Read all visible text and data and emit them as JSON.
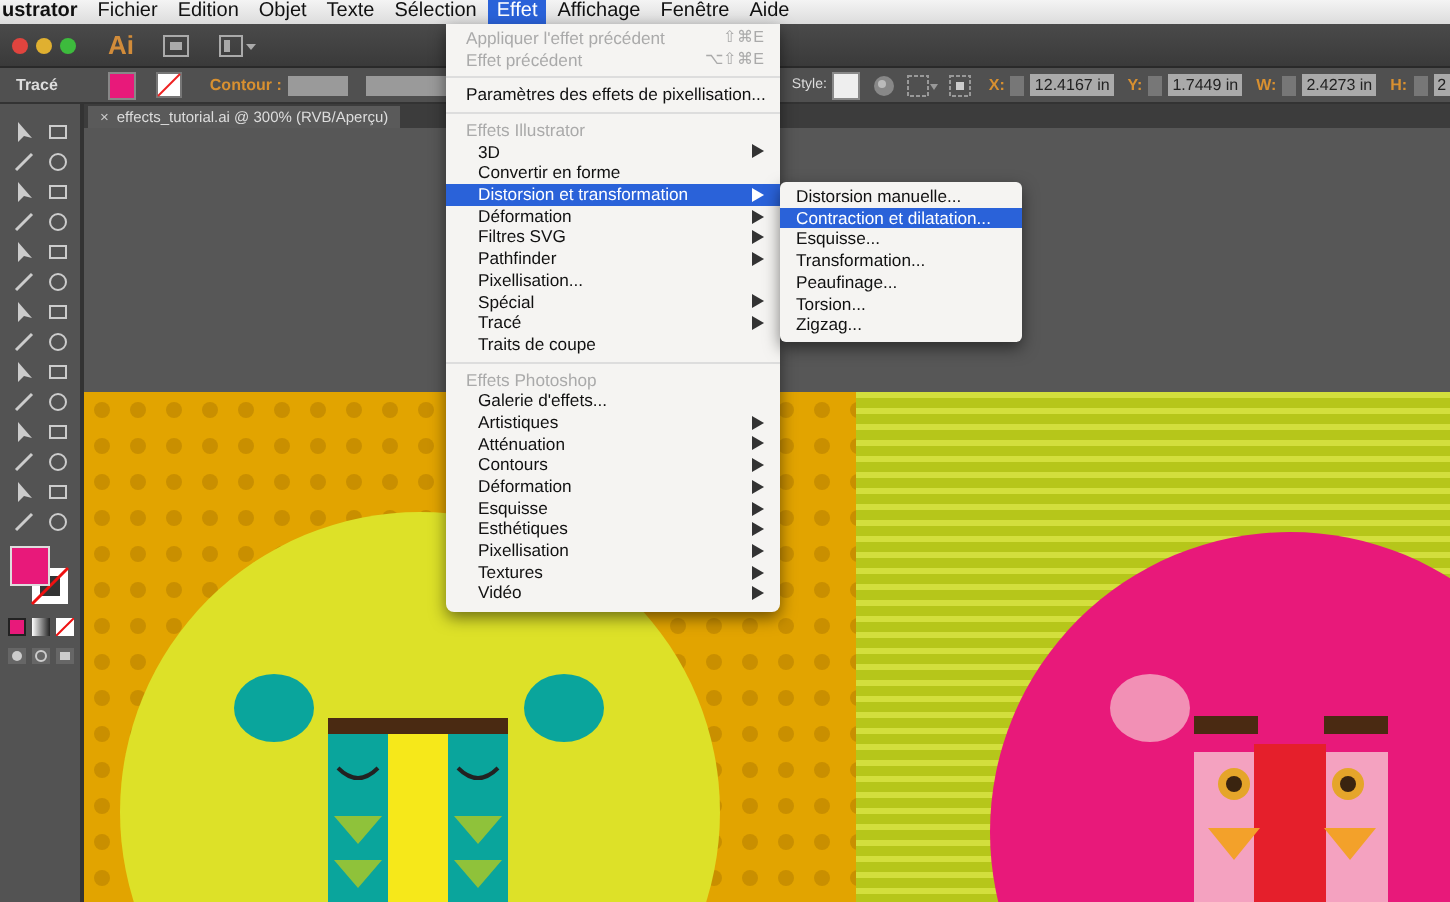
{
  "menu_bar": {
    "items": [
      {
        "label": "ustrator",
        "selected": false
      },
      {
        "label": "Fichier",
        "selected": false
      },
      {
        "label": "Edition",
        "selected": false
      },
      {
        "label": "Objet",
        "selected": false
      },
      {
        "label": "Texte",
        "selected": false
      },
      {
        "label": "Sélection",
        "selected": false
      },
      {
        "label": "Effet",
        "selected": true
      },
      {
        "label": "Affichage",
        "selected": false
      },
      {
        "label": "Fenêtre",
        "selected": false
      },
      {
        "label": "Aide",
        "selected": false
      }
    ]
  },
  "app_bar": {
    "logo": "Ai"
  },
  "control_bar": {
    "panel_label": "Tracé",
    "stroke_label": "Contour :",
    "style_label": "Style:",
    "fields": [
      {
        "label": "X:",
        "value": "12.4167 in"
      },
      {
        "label": "Y:",
        "value": "1.7449 in"
      },
      {
        "label": "W:",
        "value": "2.4273 in"
      },
      {
        "label": "H:",
        "value": "2"
      }
    ]
  },
  "document_tab": {
    "close": "×",
    "title": "effects_tutorial.ai @ 300% (RVB/Aperçu)"
  },
  "effect_menu": {
    "sections": [
      {
        "items": [
          {
            "label": "Appliquer l'effet précédent",
            "shortcut": "⇧⌘E",
            "disabled": true,
            "submenu": false,
            "selected": false
          },
          {
            "label": "Effet précédent",
            "shortcut": "⌥⇧⌘E",
            "disabled": true,
            "submenu": false,
            "selected": false
          }
        ]
      },
      {
        "items": [
          {
            "label": "Paramètres des effets de pixellisation...",
            "disabled": false,
            "submenu": false,
            "selected": false
          }
        ]
      },
      {
        "header": "Effets Illustrator",
        "items": [
          {
            "label": "3D",
            "disabled": false,
            "submenu": true,
            "selected": false
          },
          {
            "label": "Convertir en forme",
            "disabled": false,
            "submenu": false,
            "selected": false
          },
          {
            "label": "Distorsion et transformation",
            "disabled": false,
            "submenu": true,
            "selected": true
          },
          {
            "label": "Déformation",
            "disabled": false,
            "submenu": true,
            "selected": false
          },
          {
            "label": "Filtres SVG",
            "disabled": false,
            "submenu": true,
            "selected": false
          },
          {
            "label": "Pathfinder",
            "disabled": false,
            "submenu": true,
            "selected": false
          },
          {
            "label": "Pixellisation...",
            "disabled": false,
            "submenu": false,
            "selected": false
          },
          {
            "label": "Spécial",
            "disabled": false,
            "submenu": true,
            "selected": false
          },
          {
            "label": "Tracé",
            "disabled": false,
            "submenu": true,
            "selected": false
          },
          {
            "label": "Traits de coupe",
            "disabled": false,
            "submenu": false,
            "selected": false
          }
        ]
      },
      {
        "header": "Effets Photoshop",
        "items": [
          {
            "label": "Galerie d'effets...",
            "disabled": false,
            "submenu": false,
            "selected": false
          },
          {
            "label": "Artistiques",
            "disabled": false,
            "submenu": true,
            "selected": false
          },
          {
            "label": "Atténuation",
            "disabled": false,
            "submenu": true,
            "selected": false
          },
          {
            "label": "Contours",
            "disabled": false,
            "submenu": true,
            "selected": false
          },
          {
            "label": "Déformation",
            "disabled": false,
            "submenu": true,
            "selected": false
          },
          {
            "label": "Esquisse",
            "disabled": false,
            "submenu": true,
            "selected": false
          },
          {
            "label": "Esthétiques",
            "disabled": false,
            "submenu": true,
            "selected": false
          },
          {
            "label": "Pixellisation",
            "disabled": false,
            "submenu": true,
            "selected": false
          },
          {
            "label": "Textures",
            "disabled": false,
            "submenu": true,
            "selected": false
          },
          {
            "label": "Vidéo",
            "disabled": false,
            "submenu": true,
            "selected": false
          }
        ]
      }
    ]
  },
  "submenu": {
    "items": [
      {
        "label": "Distorsion manuelle...",
        "selected": false
      },
      {
        "label": "Contraction et dilatation...",
        "selected": true
      },
      {
        "label": "Esquisse...",
        "selected": false
      },
      {
        "label": "Transformation...",
        "selected": false
      },
      {
        "label": "Peaufinage...",
        "selected": false
      },
      {
        "label": "Torsion...",
        "selected": false
      },
      {
        "label": "Zigzag...",
        "selected": false
      }
    ]
  }
}
